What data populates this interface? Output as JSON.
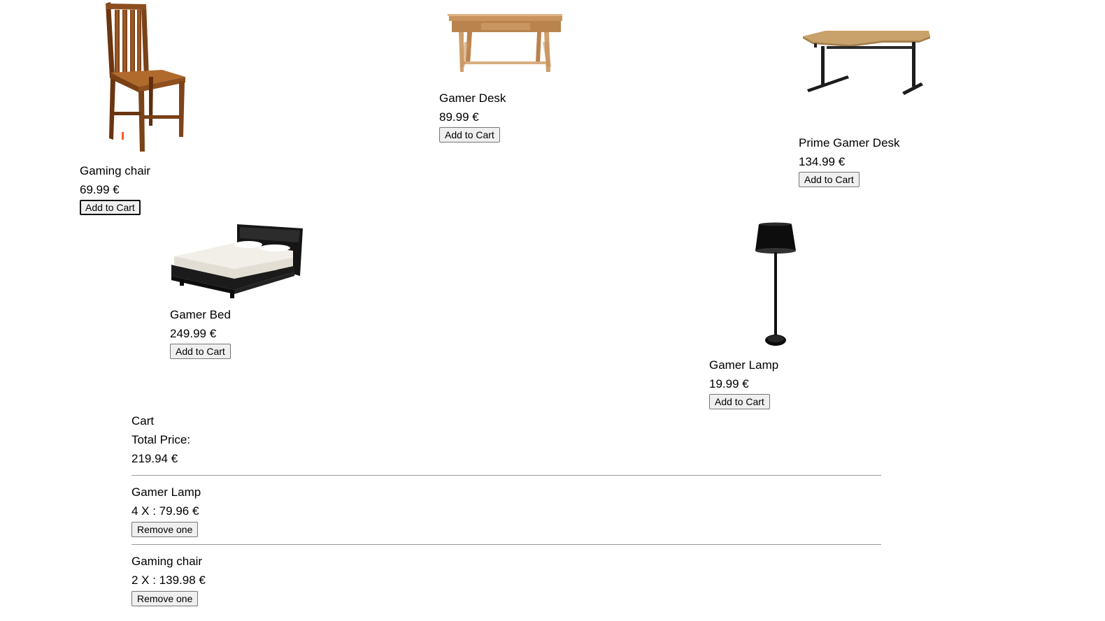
{
  "products": [
    {
      "name": "Gaming chair",
      "price": "69.99 €",
      "button": "Add to Cart",
      "icon": "chair-icon"
    },
    {
      "name": "Gamer Desk",
      "price": "89.99 €",
      "button": "Add to Cart",
      "icon": "desk-icon"
    },
    {
      "name": "Prime Gamer Desk",
      "price": "134.99 €",
      "button": "Add to Cart",
      "icon": "corner-desk-icon"
    },
    {
      "name": "Gamer Bed",
      "price": "249.99 €",
      "button": "Add to Cart",
      "icon": "bed-icon"
    },
    {
      "name": "Gamer Lamp",
      "price": "19.99 €",
      "button": "Add to Cart",
      "icon": "floor-lamp-icon"
    }
  ],
  "cart": {
    "title": "Cart",
    "total_label": "Total Price:",
    "total_value": "219.94 €",
    "items": [
      {
        "name": "Gamer Lamp",
        "summary": "4 X : 79.96 €",
        "button": "Remove one"
      },
      {
        "name": "Gaming chair",
        "summary": "2 X : 139.98 €",
        "button": "Remove one"
      }
    ]
  }
}
